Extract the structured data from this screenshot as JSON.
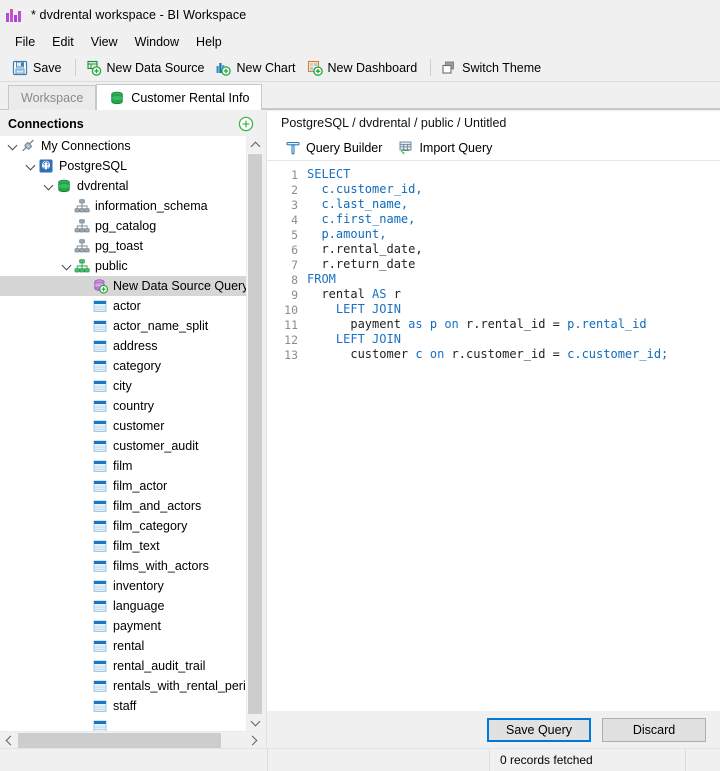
{
  "window": {
    "title": "* dvdrental workspace - BI Workspace",
    "icon": "bar-chart-icon"
  },
  "menubar": {
    "items": [
      {
        "label": "File"
      },
      {
        "label": "Edit"
      },
      {
        "label": "View"
      },
      {
        "label": "Window"
      },
      {
        "label": "Help"
      }
    ]
  },
  "toolbar": {
    "buttons": [
      {
        "label": "Save",
        "icon": "save-icon"
      },
      {
        "label": "New Data Source",
        "icon": "new-data-source-icon"
      },
      {
        "label": "New Chart",
        "icon": "new-chart-icon"
      },
      {
        "label": "New Dashboard",
        "icon": "new-dashboard-icon"
      },
      {
        "label": "Switch Theme",
        "icon": "switch-theme-icon"
      }
    ]
  },
  "tabs": [
    {
      "label": "Workspace",
      "active": false,
      "icon": null
    },
    {
      "label": "Customer Rental Info",
      "active": true,
      "icon": "database-green-icon"
    }
  ],
  "connections": {
    "header": "Connections",
    "add_button_icon": "plus-circle-icon",
    "tree": [
      {
        "label": "My Connections",
        "depth": 0,
        "chev": "open",
        "icon": "plug-icon",
        "selected": false
      },
      {
        "label": "PostgreSQL",
        "depth": 1,
        "chev": "open",
        "icon": "postgres-icon",
        "selected": false
      },
      {
        "label": "dvdrental",
        "depth": 2,
        "chev": "open",
        "icon": "database-green-icon",
        "selected": false
      },
      {
        "label": "information_schema",
        "depth": 3,
        "chev": "none",
        "icon": "schema-icon",
        "selected": false
      },
      {
        "label": "pg_catalog",
        "depth": 3,
        "chev": "none",
        "icon": "schema-icon",
        "selected": false
      },
      {
        "label": "pg_toast",
        "depth": 3,
        "chev": "none",
        "icon": "schema-icon",
        "selected": false
      },
      {
        "label": "public",
        "depth": 3,
        "chev": "open",
        "icon": "schema-green-icon",
        "selected": false
      },
      {
        "label": "New Data Source Query",
        "depth": 4,
        "chev": "none",
        "icon": "new-query-icon",
        "selected": true
      },
      {
        "label": "actor",
        "depth": 4,
        "chev": "none",
        "icon": "table-icon",
        "selected": false
      },
      {
        "label": "actor_name_split",
        "depth": 4,
        "chev": "none",
        "icon": "table-icon",
        "selected": false
      },
      {
        "label": "address",
        "depth": 4,
        "chev": "none",
        "icon": "table-icon",
        "selected": false
      },
      {
        "label": "category",
        "depth": 4,
        "chev": "none",
        "icon": "table-icon",
        "selected": false
      },
      {
        "label": "city",
        "depth": 4,
        "chev": "none",
        "icon": "table-icon",
        "selected": false
      },
      {
        "label": "country",
        "depth": 4,
        "chev": "none",
        "icon": "table-icon",
        "selected": false
      },
      {
        "label": "customer",
        "depth": 4,
        "chev": "none",
        "icon": "table-icon",
        "selected": false
      },
      {
        "label": "customer_audit",
        "depth": 4,
        "chev": "none",
        "icon": "table-icon",
        "selected": false
      },
      {
        "label": "film",
        "depth": 4,
        "chev": "none",
        "icon": "table-icon",
        "selected": false
      },
      {
        "label": "film_actor",
        "depth": 4,
        "chev": "none",
        "icon": "table-icon",
        "selected": false
      },
      {
        "label": "film_and_actors",
        "depth": 4,
        "chev": "none",
        "icon": "table-icon",
        "selected": false
      },
      {
        "label": "film_category",
        "depth": 4,
        "chev": "none",
        "icon": "table-icon",
        "selected": false
      },
      {
        "label": "film_text",
        "depth": 4,
        "chev": "none",
        "icon": "table-icon",
        "selected": false
      },
      {
        "label": "films_with_actors",
        "depth": 4,
        "chev": "none",
        "icon": "table-icon",
        "selected": false
      },
      {
        "label": "inventory",
        "depth": 4,
        "chev": "none",
        "icon": "table-icon",
        "selected": false
      },
      {
        "label": "language",
        "depth": 4,
        "chev": "none",
        "icon": "table-icon",
        "selected": false
      },
      {
        "label": "payment",
        "depth": 4,
        "chev": "none",
        "icon": "table-icon",
        "selected": false
      },
      {
        "label": "rental",
        "depth": 4,
        "chev": "none",
        "icon": "table-icon",
        "selected": false
      },
      {
        "label": "rental_audit_trail",
        "depth": 4,
        "chev": "none",
        "icon": "table-icon",
        "selected": false
      },
      {
        "label": "rentals_with_rental_perio",
        "depth": 4,
        "chev": "none",
        "icon": "table-icon",
        "selected": false
      },
      {
        "label": "staff",
        "depth": 4,
        "chev": "none",
        "icon": "table-icon",
        "selected": false
      }
    ]
  },
  "query_panel": {
    "breadcrumb": "PostgreSQL / dvdrental / public / Untitled",
    "toolbar": [
      {
        "label": "Query Builder",
        "icon": "query-builder-icon"
      },
      {
        "label": "Import Query",
        "icon": "import-query-icon"
      }
    ],
    "editor": {
      "lines": [
        {
          "n": "1",
          "tokens": [
            {
              "t": "SELECT",
              "c": "kw"
            }
          ]
        },
        {
          "n": "2",
          "tokens": [
            {
              "t": "  ",
              "c": "plain"
            },
            {
              "t": "c.customer_id,",
              "c": "ident"
            }
          ]
        },
        {
          "n": "3",
          "tokens": [
            {
              "t": "  ",
              "c": "plain"
            },
            {
              "t": "c.last_name,",
              "c": "ident"
            }
          ]
        },
        {
          "n": "4",
          "tokens": [
            {
              "t": "  ",
              "c": "plain"
            },
            {
              "t": "c.first_name,",
              "c": "ident"
            }
          ]
        },
        {
          "n": "5",
          "tokens": [
            {
              "t": "  ",
              "c": "plain"
            },
            {
              "t": "p.amount,",
              "c": "ident"
            }
          ]
        },
        {
          "n": "6",
          "tokens": [
            {
              "t": "  ",
              "c": "plain"
            },
            {
              "t": "r.rental_date,",
              "c": "plain"
            }
          ]
        },
        {
          "n": "7",
          "tokens": [
            {
              "t": "  ",
              "c": "plain"
            },
            {
              "t": "r.return_date",
              "c": "plain"
            }
          ]
        },
        {
          "n": "8",
          "tokens": [
            {
              "t": "FROM",
              "c": "kw"
            }
          ]
        },
        {
          "n": "9",
          "tokens": [
            {
              "t": "  rental ",
              "c": "plain"
            },
            {
              "t": "AS",
              "c": "kw"
            },
            {
              "t": " r",
              "c": "plain"
            }
          ]
        },
        {
          "n": "10",
          "tokens": [
            {
              "t": "    ",
              "c": "plain"
            },
            {
              "t": "LEFT JOIN",
              "c": "kw"
            }
          ]
        },
        {
          "n": "11",
          "tokens": [
            {
              "t": "      payment ",
              "c": "plain"
            },
            {
              "t": "as",
              "c": "kw"
            },
            {
              "t": " ",
              "c": "plain"
            },
            {
              "t": "p",
              "c": "ident"
            },
            {
              "t": " ",
              "c": "plain"
            },
            {
              "t": "on",
              "c": "kw"
            },
            {
              "t": " r.rental_id = ",
              "c": "plain"
            },
            {
              "t": "p.rental_id",
              "c": "ident"
            }
          ]
        },
        {
          "n": "12",
          "tokens": [
            {
              "t": "    ",
              "c": "plain"
            },
            {
              "t": "LEFT JOIN",
              "c": "kw"
            }
          ]
        },
        {
          "n": "13",
          "tokens": [
            {
              "t": "      customer ",
              "c": "plain"
            },
            {
              "t": "c",
              "c": "ident"
            },
            {
              "t": " ",
              "c": "plain"
            },
            {
              "t": "on",
              "c": "kw"
            },
            {
              "t": " r.customer_id = ",
              "c": "plain"
            },
            {
              "t": "c.customer_id;",
              "c": "ident"
            }
          ]
        }
      ]
    },
    "actions": {
      "save_label": "Save Query",
      "discard_label": "Discard"
    }
  },
  "statusbar": {
    "cell1": "",
    "cell2": "",
    "records": "0 records fetched",
    "cell4": ""
  },
  "colors": {
    "accent": "#0078d7",
    "keyword": "#1a72c4",
    "identifier": "#0f6bbd",
    "selection": "#d6d6d6",
    "chrome": "#f0f0f0"
  }
}
